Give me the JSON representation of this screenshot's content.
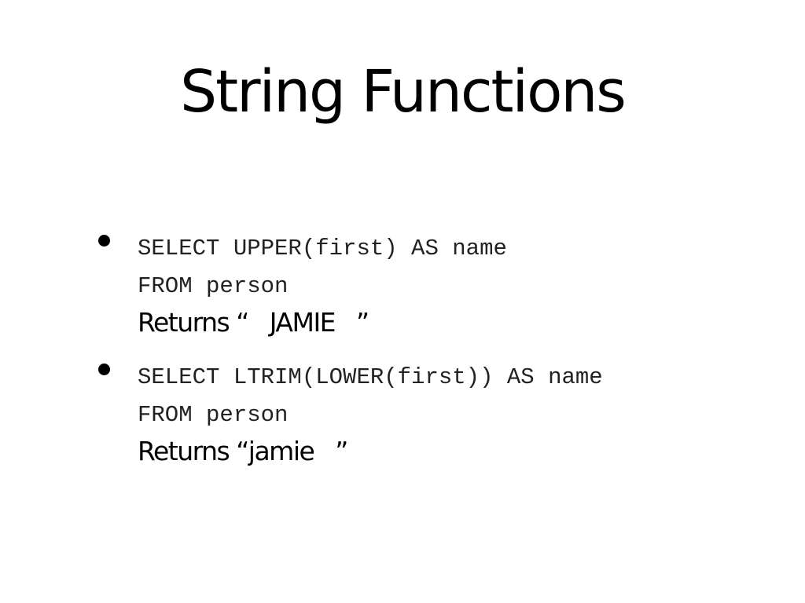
{
  "slide": {
    "title": "String Functions",
    "bullets": [
      {
        "code_lines": [
          "SELECT UPPER(first) AS name",
          "FROM person"
        ],
        "result": "Returns “   JAMIE   ”"
      },
      {
        "code_lines": [
          "SELECT LTRIM(LOWER(first)) AS name",
          "FROM person"
        ],
        "result": "Returns “jamie   ”"
      }
    ]
  }
}
